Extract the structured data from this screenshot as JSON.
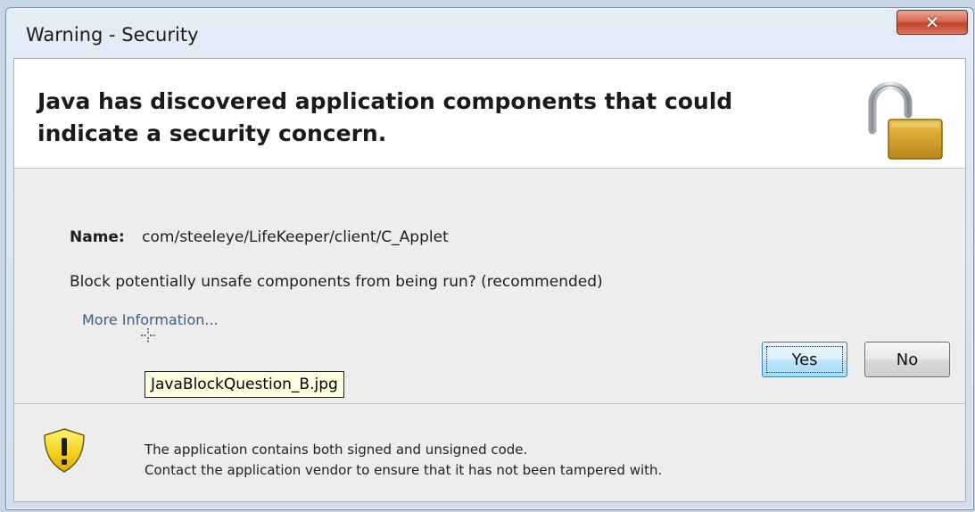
{
  "window": {
    "title": "Warning - Security",
    "close_glyph": "✕"
  },
  "header": {
    "headline": "Java has discovered application components that could indicate a security concern.",
    "icon": "padlock-open-icon"
  },
  "details": {
    "name_label": "Name:",
    "name_value": "com/steeleye/LifeKeeper/client/C_Applet",
    "question": "Block potentially unsafe components from being run? (recommended)",
    "more_info_link": "More Information..."
  },
  "tooltip": {
    "text": "JavaBlockQuestion_B.jpg"
  },
  "buttons": {
    "yes_label": "Yes",
    "no_label": "No"
  },
  "footer": {
    "icon": "warning-shield-icon",
    "line1": "The application contains both signed and unsigned code.",
    "line2": "Contact the application vendor to ensure that it has not been tampered with."
  },
  "colors": {
    "link": "#3b5d8a",
    "close_button": "#c0432b",
    "lock_gold": "#d4a22e",
    "warning_yellow": "#f3d21c",
    "tooltip_bg": "#ffffe1"
  }
}
